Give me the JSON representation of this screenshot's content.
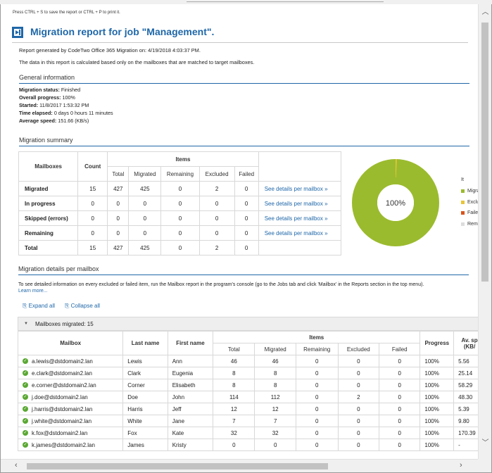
{
  "hint": "Press CTRL + S to save the report or CTRL + P to print it.",
  "title": "Migration report for job \"Management\".",
  "generated_line": "Report generated by CodeTwo Office 365 Migration on: 4/19/2018 4:03:37 PM.",
  "data_line": "The data in this report is calculated based only on the mailboxes that are matched to target mailboxes.",
  "general": {
    "heading": "General information",
    "status_label": "Migration status:",
    "status_value": "Finished",
    "progress_label": "Overall progress:",
    "progress_value": "100%",
    "started_label": "Started:",
    "started_value": "11/8/2017 1:53:32 PM",
    "elapsed_label": "Time elapsed:",
    "elapsed_value": "0 days 0 hours 11 minutes",
    "speed_label": "Average speed:",
    "speed_value": "151.66 (KB/s)"
  },
  "summary": {
    "heading": "Migration summary",
    "headers": {
      "mailboxes": "Mailboxes",
      "count": "Count",
      "items": "Items",
      "total": "Total",
      "migrated": "Migrated",
      "remaining": "Remaining",
      "excluded": "Excluded",
      "failed": "Failed"
    },
    "link_text": "See details per mailbox »",
    "rows": [
      {
        "label": "Migrated",
        "count": "15",
        "total": "427",
        "migrated": "425",
        "remaining": "0",
        "excluded": "2",
        "failed": "0"
      },
      {
        "label": "In progress",
        "count": "0",
        "total": "0",
        "migrated": "0",
        "remaining": "0",
        "excluded": "0",
        "failed": "0"
      },
      {
        "label": "Skipped (errors)",
        "count": "0",
        "total": "0",
        "migrated": "0",
        "remaining": "0",
        "excluded": "0",
        "failed": "0"
      },
      {
        "label": "Remaining",
        "count": "0",
        "total": "0",
        "migrated": "0",
        "remaining": "0",
        "excluded": "0",
        "failed": "0"
      }
    ],
    "total_row": {
      "label": "Total",
      "count": "15",
      "total": "427",
      "migrated": "425",
      "remaining": "0",
      "excluded": "2",
      "failed": "0"
    }
  },
  "donut": {
    "center_label": "100%",
    "legend_title": "It",
    "legend": [
      {
        "label": "Migra",
        "color": "#9bbb2e"
      },
      {
        "label": "Exclu",
        "color": "#e8c53a"
      },
      {
        "label": "Faile",
        "color": "#d9541e"
      },
      {
        "label": "Rem",
        "color": "#dddddd"
      }
    ]
  },
  "details": {
    "heading": "Migration details per mailbox",
    "description": "To see detailed information on every excluded or failed item, run the Mailbox report in the program's console (go to the Jobs tab and click 'Mailbox' in the Reports section in the top menu).",
    "learn_more": "Learn more...",
    "expand_all": "Expand all",
    "collapse_all": "Collapse all",
    "group_label": "Mailboxes migrated: 15",
    "headers": {
      "mailbox": "Mailbox",
      "last": "Last name",
      "first": "First name",
      "items": "Items",
      "total": "Total",
      "migrated": "Migrated",
      "remaining": "Remaining",
      "excluded": "Excluded",
      "failed": "Failed",
      "progress": "Progress",
      "avspeed": "Av. sp",
      "avspeed2": "(KB/"
    },
    "rows": [
      {
        "mailbox": "a.lewis@dstdomain2.lan",
        "last": "Lewis",
        "first": "Ann",
        "total": "46",
        "migrated": "46",
        "remaining": "0",
        "excluded": "0",
        "failed": "0",
        "progress": "100%",
        "speed": "5.56"
      },
      {
        "mailbox": "e.clark@dstdomain2.lan",
        "last": "Clark",
        "first": "Eugenia",
        "total": "8",
        "migrated": "8",
        "remaining": "0",
        "excluded": "0",
        "failed": "0",
        "progress": "100%",
        "speed": "25.14"
      },
      {
        "mailbox": "e.corner@dstdomain2.lan",
        "last": "Corner",
        "first": "Elisabeth",
        "total": "8",
        "migrated": "8",
        "remaining": "0",
        "excluded": "0",
        "failed": "0",
        "progress": "100%",
        "speed": "58.29"
      },
      {
        "mailbox": "j.doe@dstdomain2.lan",
        "last": "Doe",
        "first": "John",
        "total": "114",
        "migrated": "112",
        "remaining": "0",
        "excluded": "2",
        "failed": "0",
        "progress": "100%",
        "speed": "48.30"
      },
      {
        "mailbox": "j.harris@dstdomain2.lan",
        "last": "Harris",
        "first": "Jeff",
        "total": "12",
        "migrated": "12",
        "remaining": "0",
        "excluded": "0",
        "failed": "0",
        "progress": "100%",
        "speed": "5.39"
      },
      {
        "mailbox": "j.white@dstdomain2.lan",
        "last": "White",
        "first": "Jane",
        "total": "7",
        "migrated": "7",
        "remaining": "0",
        "excluded": "0",
        "failed": "0",
        "progress": "100%",
        "speed": "9.80"
      },
      {
        "mailbox": "k.fox@dstdomain2.lan",
        "last": "Fox",
        "first": "Kate",
        "total": "32",
        "migrated": "32",
        "remaining": "0",
        "excluded": "0",
        "failed": "0",
        "progress": "100%",
        "speed": "170.39"
      },
      {
        "mailbox": "k.james@dstdomain2.lan",
        "last": "James",
        "first": "Kristy",
        "total": "0",
        "migrated": "0",
        "remaining": "0",
        "excluded": "0",
        "failed": "0",
        "progress": "100%",
        "speed": "-"
      }
    ]
  }
}
